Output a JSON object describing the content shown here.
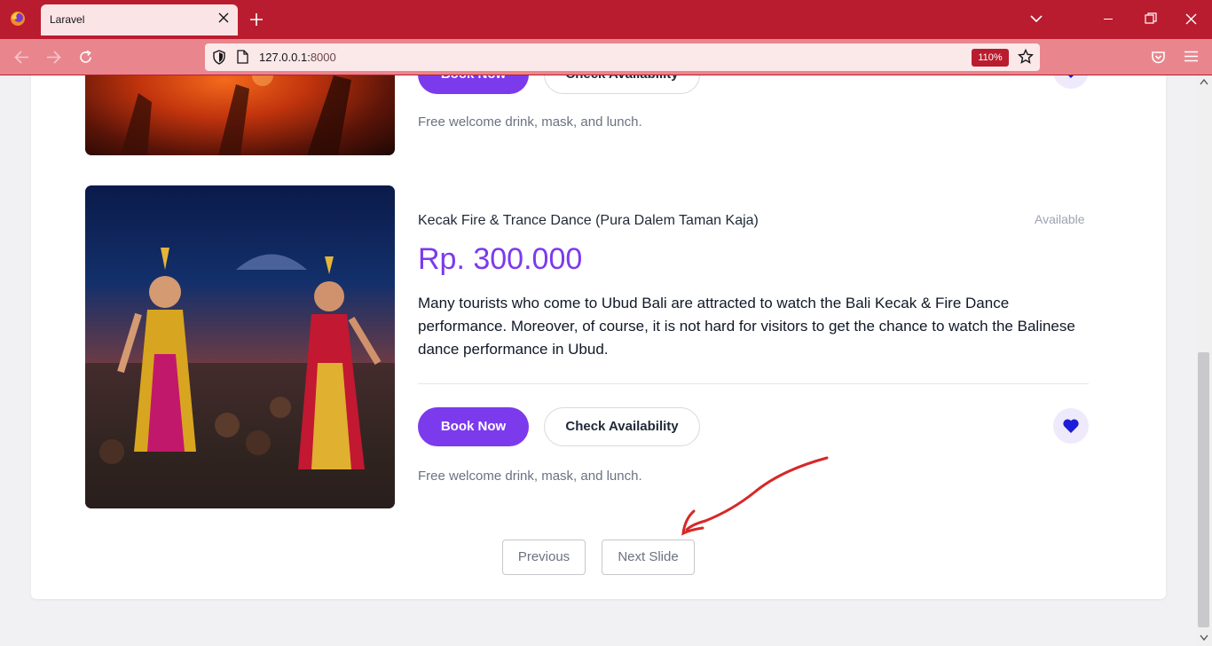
{
  "browser": {
    "tab_title": "Laravel",
    "url_host": "127.0.0.1:",
    "url_port": "8000",
    "zoom": "110%"
  },
  "previous_item": {
    "book_label": "Book Now",
    "check_label": "Check Availability",
    "note": "Free welcome drink, mask, and lunch."
  },
  "item": {
    "title": "Kecak Fire & Trance Dance (Pura Dalem Taman Kaja)",
    "status": "Available",
    "price": "Rp. 300.000",
    "description": "Many tourists who come to Ubud Bali are attracted to watch the Bali Kecak & Fire Dance performance. Moreover, of course, it is not hard for visitors to get the chance to watch the Balinese dance performance in Ubud.",
    "book_label": "Book Now",
    "check_label": "Check Availability",
    "note": "Free welcome drink, mask, and lunch."
  },
  "pager": {
    "previous_label": "Previous",
    "next_label": "Next Slide"
  },
  "colors": {
    "chrome": "#b91c2e",
    "accent": "#7c3aed",
    "heart": "#1d1dd8"
  }
}
